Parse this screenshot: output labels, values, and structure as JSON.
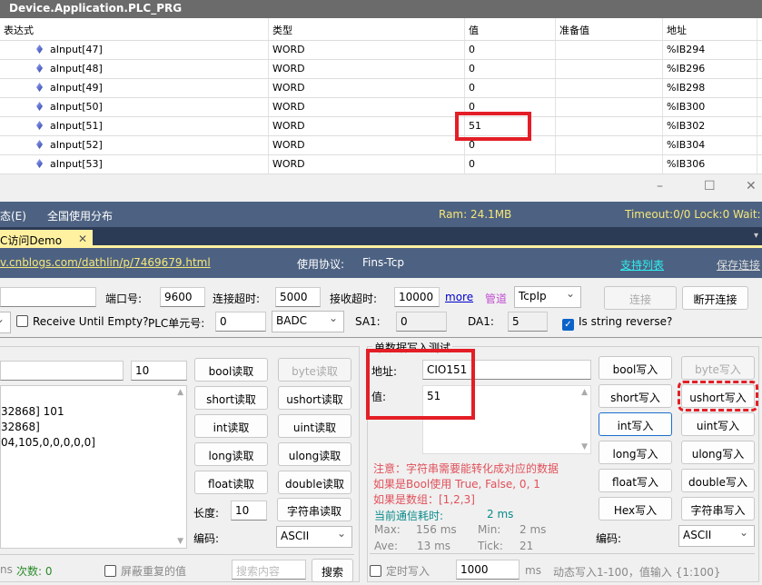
{
  "watch": {
    "title": "Device.Application.PLC_PRG",
    "headers": [
      "表达式",
      "类型",
      "值",
      "准备值",
      "地址"
    ],
    "rows": [
      {
        "expr": "aInput[47]",
        "type": "WORD",
        "value": "0",
        "addr": "%IB294"
      },
      {
        "expr": "aInput[48]",
        "type": "WORD",
        "value": "0",
        "addr": "%IB296"
      },
      {
        "expr": "aInput[49]",
        "type": "WORD",
        "value": "0",
        "addr": "%IB298"
      },
      {
        "expr": "aInput[50]",
        "type": "WORD",
        "value": "0",
        "addr": "%IB300"
      },
      {
        "expr": "aInput[51]",
        "type": "WORD",
        "value": "51",
        "addr": "%IB302"
      },
      {
        "expr": "aInput[52]",
        "type": "WORD",
        "value": "0",
        "addr": "%IB304"
      },
      {
        "expr": "aInput[53]",
        "type": "WORD",
        "value": "0",
        "addr": "%IB306"
      }
    ]
  },
  "window": {
    "min": "–",
    "max": "☐",
    "close": "✕"
  },
  "menu": {
    "item1": "态(E)",
    "item2": "全国使用分布",
    "ram": "Ram: 24.1MB",
    "status": "Timeout:0/0  Lock:0  Wait:"
  },
  "tab": {
    "label": "C访问Demo",
    "close": "✕",
    "overflow": "▾"
  },
  "linkbar": {
    "url": "v.cnblogs.com/dathlin/p/7469679.html",
    "protocol_label": "使用协议:",
    "protocol": "Fins-Tcp",
    "support": "支持列表",
    "save": "保存连接"
  },
  "conn": {
    "port_label": "端口号:",
    "port": "9600",
    "conn_timeout_label": "连接超时:",
    "conn_timeout": "5000",
    "recv_timeout_label": "接收超时:",
    "recv_timeout": "10000",
    "more": "more",
    "pipe": "管道",
    "pipe_value": "TcpIp",
    "connect": "连接",
    "disconnect": "断开连接",
    "receive_until_empty": "Receive Until Empty?",
    "plc_unit_label": "PLC单元号:",
    "plc_unit": "0",
    "byte_order": "BADC",
    "sa1_label": "SA1:",
    "sa1": "0",
    "da1_label": "DA1:",
    "da1": "5",
    "string_reverse": "Is string reverse?"
  },
  "read": {
    "length_field": "10",
    "output": [
      "32868] 101",
      "32868]",
      "04,105,0,0,0,0,0]"
    ],
    "buttons": [
      "bool读取",
      "byte读取",
      "short读取",
      "ushort读取",
      "int读取",
      "uint读取",
      "long读取",
      "ulong读取",
      "float读取",
      "double读取"
    ],
    "length_label": "长度:",
    "length": "10",
    "string_read": "字符串读取",
    "encoding_label": "编码:",
    "encoding": "ASCII",
    "ms_suffix": "ns",
    "count": "次数: 0",
    "mask_dup": "屏蔽重复的值",
    "search_placeholder": "搜索内容",
    "search": "搜索"
  },
  "write": {
    "group_title": "单数据写入测试",
    "addr_label": "地址:",
    "addr": "CIO151",
    "value_label": "值:",
    "value": "51",
    "notes": [
      "注意：字符串需要能转化成对应的数据",
      "如果是Bool使用 True, False, 0, 1",
      "如果是数组：[1,2,3]"
    ],
    "elapsed_label": "当前通信耗时:",
    "elapsed": "2 ms",
    "max_label": "Max:",
    "max": "156 ms",
    "min_label": "Min:",
    "min": "2 ms",
    "ave_label": "Ave:",
    "ave": "13 ms",
    "tick_label": "Tick:",
    "tick": "21",
    "buttons": [
      "bool写入",
      "byte写入",
      "short写入",
      "ushort写入",
      "int写入",
      "uint写入",
      "long写入",
      "ulong写入",
      "float写入",
      "double写入",
      "Hex写入",
      "字符串写入"
    ],
    "encoding_label": "编码:",
    "encoding": "ASCII",
    "timed_write": "定时写入",
    "interval": "1000",
    "ms": "ms",
    "dynamic_hint": "动态写入1-100，值输入 {1:100}"
  }
}
